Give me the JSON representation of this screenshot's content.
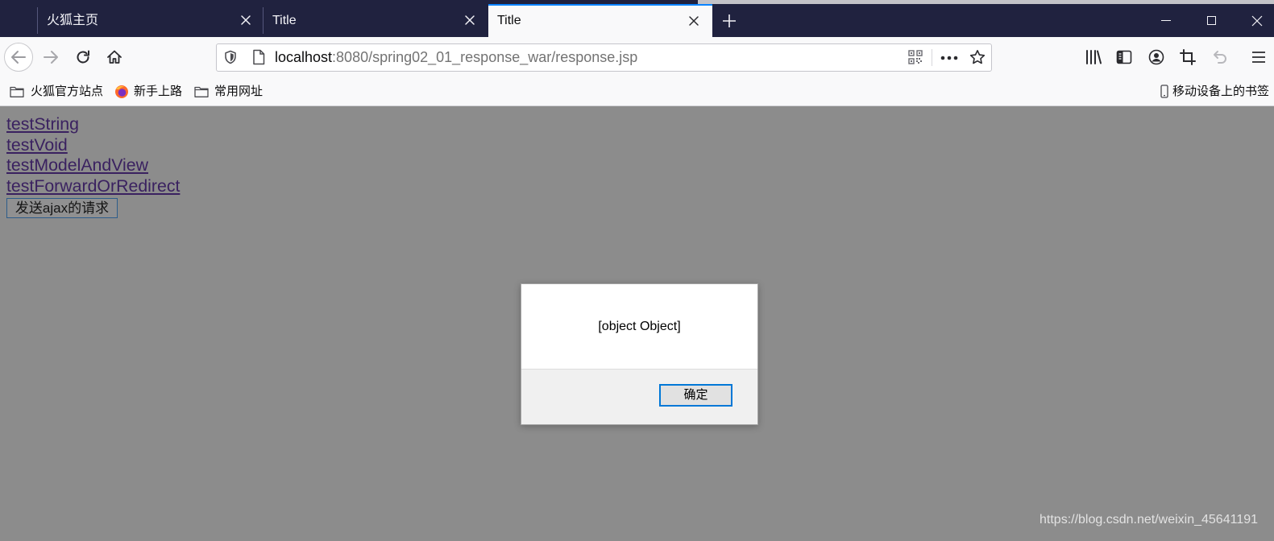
{
  "browser": {
    "tabs": [
      {
        "label": "火狐主页",
        "active": false
      },
      {
        "label": "Title",
        "active": false
      },
      {
        "label": "Title",
        "active": true
      }
    ],
    "icons": {
      "tab_close": "close-icon",
      "new_tab": "plus-icon",
      "minimize": "minimize-icon",
      "maximize": "maximize-icon",
      "close_window": "close-icon"
    }
  },
  "toolbar": {
    "url": {
      "host": "localhost",
      "path": ":8080/spring02_01_response_war/response.jsp"
    },
    "icons": {
      "back": "back-arrow-icon",
      "forward": "forward-arrow-icon",
      "reload": "reload-icon",
      "home": "home-icon",
      "tracking_protection": "shield-icon",
      "site_info": "page-icon",
      "qr_code": "qr-code-icon",
      "page_actions": "more-dots-icon",
      "bookmark": "star-icon",
      "library": "library-icon",
      "sidebar": "sidebar-icon",
      "account": "account-icon",
      "screenshot": "crop-icon",
      "undo": "undo-icon",
      "menu": "hamburger-menu-icon"
    }
  },
  "bookmarks": {
    "items": [
      {
        "label": "火狐官方站点",
        "icon": "folder-icon"
      },
      {
        "label": "新手上路",
        "icon": "firefox-logo-icon"
      },
      {
        "label": "常用网址",
        "icon": "folder-icon"
      }
    ],
    "mobile": {
      "label": "移动设备上的书签",
      "icon": "mobile-phone-icon"
    }
  },
  "page": {
    "links": [
      {
        "label": "testString"
      },
      {
        "label": "testVoid"
      },
      {
        "label": "testModelAndView"
      },
      {
        "label": "testForwardOrRedirect"
      }
    ],
    "ajax_button": "发送ajax的请求"
  },
  "alert_dialog": {
    "message": "[object Object]",
    "ok_button": "确定"
  },
  "watermark": "https://blog.csdn.net/weixin_45641191",
  "colors": {
    "tab_bar": "#20223f",
    "tab_accent": "#0a84ff",
    "toolbar": "#f9f9fa",
    "page_overlay": "#8c8c8c",
    "visited_link": "#3a2160",
    "dialog_button_border": "#0078d7"
  }
}
